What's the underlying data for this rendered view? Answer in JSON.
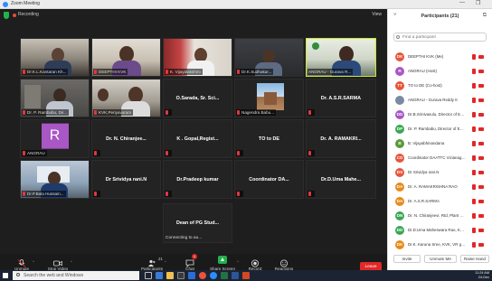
{
  "window": {
    "title": "Zoom Meeting",
    "controls": [
      "—",
      "❐"
    ]
  },
  "topbar": {
    "recording_label": "Recording",
    "view_label": "View"
  },
  "tiles": [
    {
      "name": "Dr.K.L.Kantaran Kh..."
    },
    {
      "name": "DEEPTHI KVK"
    },
    {
      "name": "K. Vijayalakshmi"
    },
    {
      "name": "Dr.K.Sudhakar..."
    },
    {
      "name": "ANGRAU - Gurava R..."
    },
    {
      "name": "Dr. P. Rambabu, Dir..."
    },
    {
      "name": "KVK,Periyavaram"
    },
    {
      "name": "O.Sarada, Sr. Sci..."
    },
    {
      "name": "Nagendra Babu..."
    },
    {
      "name": "Dr. A.S.R.SARMA"
    },
    {
      "name": "ANGRAU",
      "avatar": "R"
    },
    {
      "name": "Dr. N. Chiranjee..."
    },
    {
      "name": "K . Gopal,Regist..."
    },
    {
      "name": "TO to DE"
    },
    {
      "name": "Dr. A. RAMAKRI..."
    },
    {
      "name": "Dr.P.Bala Hussain..."
    },
    {
      "name": "Dr Srividya rani.N"
    },
    {
      "name": "Dr.Pradeep kumar"
    },
    {
      "name": "Coordinator DA..."
    },
    {
      "name": "Dr.D.Uma Mahe..."
    },
    {
      "name": "Dean of PG Stud...",
      "status": "Connecting to au..."
    }
  ],
  "toolbar": {
    "unmute": "Unmute",
    "stop_video": "Stop Video",
    "participants": "Participants",
    "participants_count": "21",
    "chat": "Chat",
    "chat_badge": "1",
    "share_screen": "Share Screen",
    "record": "Record",
    "reactions": "Reactions",
    "end": "Leave"
  },
  "panel": {
    "title": "Participants (21)",
    "search_placeholder": "Find a participant",
    "participants": [
      {
        "initials": "DK",
        "name": "DEEPTHI KVK (Me)",
        "color": "#e8553a"
      },
      {
        "initials": "R",
        "name": "ANGRAU (Host)",
        "color": "#a857c4"
      },
      {
        "initials": "TT",
        "name": "TO to DE (Co-host)",
        "color": "#e8553a"
      },
      {
        "initials": "",
        "name": "ANGRAU - Gurava Reddy K",
        "color": "#7a8aa0"
      },
      {
        "initials": "DD",
        "name": "Dr.B.Srinivasulu, Director of Exte...",
        "color": "#a857c4"
      },
      {
        "initials": "DP",
        "name": "Dr. P. Rambabu, Director of Ext...",
        "color": "#3aa757"
      },
      {
        "initials": "B",
        "name": "B. Vijayabhinandana",
        "color": "#5a9a3a"
      },
      {
        "initials": "CD",
        "name": "Coordinator DAATTC Vizianagar...",
        "color": "#e8553a"
      },
      {
        "initials": "DS",
        "name": "Dr Srividya rani.N",
        "color": "#e8553a"
      },
      {
        "initials": "DA",
        "name": "Dr. A. RAMAKRISHNA RAO",
        "color": "#e88a1a"
      },
      {
        "initials": "DA",
        "name": "Dr. A.S.R.SARMA",
        "color": "#e88a1a"
      },
      {
        "initials": "DN",
        "name": "Dr. N. Chiranjeevi, Rtd, Plant Pat...",
        "color": "#3aa757"
      },
      {
        "initials": "DD",
        "name": "Dr.D.Uma Maheswara Rao, KVK,...",
        "color": "#3aa757"
      },
      {
        "initials": "DK",
        "name": "Dr.K. Karuna Sree, KVK, VR gud...",
        "color": "#e88a1a"
      }
    ],
    "footer": {
      "invite": "Invite",
      "unmute_me": "Unmute Me",
      "raise_hand": "Raise Hand"
    }
  },
  "taskbar": {
    "search_placeholder": "Search the web and Windows",
    "time": "11:24 AM",
    "date": "24-Dec"
  }
}
